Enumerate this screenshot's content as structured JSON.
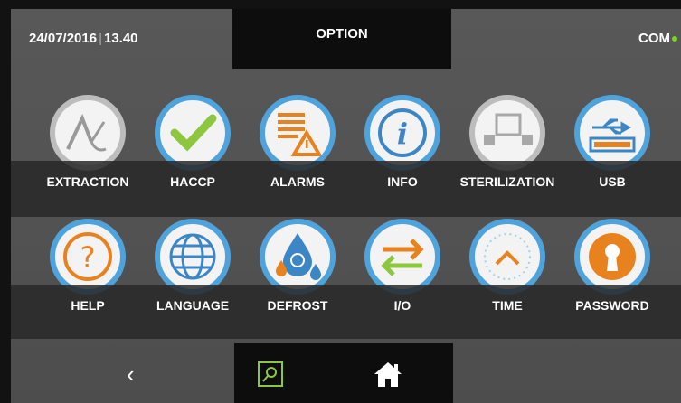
{
  "header": {
    "date": "24/07/2016",
    "separator": "|",
    "time": "13.40",
    "title": "OPTION",
    "com_label": "COM",
    "com_status_color": "#7ed321"
  },
  "row1": [
    {
      "label": "EXTRACTION",
      "icon": "extraction-probe-icon"
    },
    {
      "label": "HACCP",
      "icon": "checkmark-icon"
    },
    {
      "label": "ALARMS",
      "icon": "alarm-warning-icon"
    },
    {
      "label": "INFO",
      "icon": "info-icon"
    },
    {
      "label": "STERILIZATION",
      "icon": "sterilization-icon"
    },
    {
      "label": "USB",
      "icon": "usb-icon"
    }
  ],
  "row2": [
    {
      "label": "HELP",
      "icon": "question-icon"
    },
    {
      "label": "LANGUAGE",
      "icon": "globe-icon"
    },
    {
      "label": "DEFROST",
      "icon": "defrost-drops-icon"
    },
    {
      "label": "I/O",
      "icon": "io-arrows-icon"
    },
    {
      "label": "TIME",
      "icon": "clock-icon"
    },
    {
      "label": "PASSWORD",
      "icon": "keyhole-icon"
    }
  ],
  "footer": {
    "back_glyph": "‹",
    "search_icon": "search-icon",
    "home_icon": "home-icon"
  },
  "colors": {
    "ring_blue": "#4fa3dd",
    "ring_grey": "#bdbdbd",
    "green": "#8dc63f",
    "orange": "#e8821e",
    "blue": "#3d86c6"
  }
}
